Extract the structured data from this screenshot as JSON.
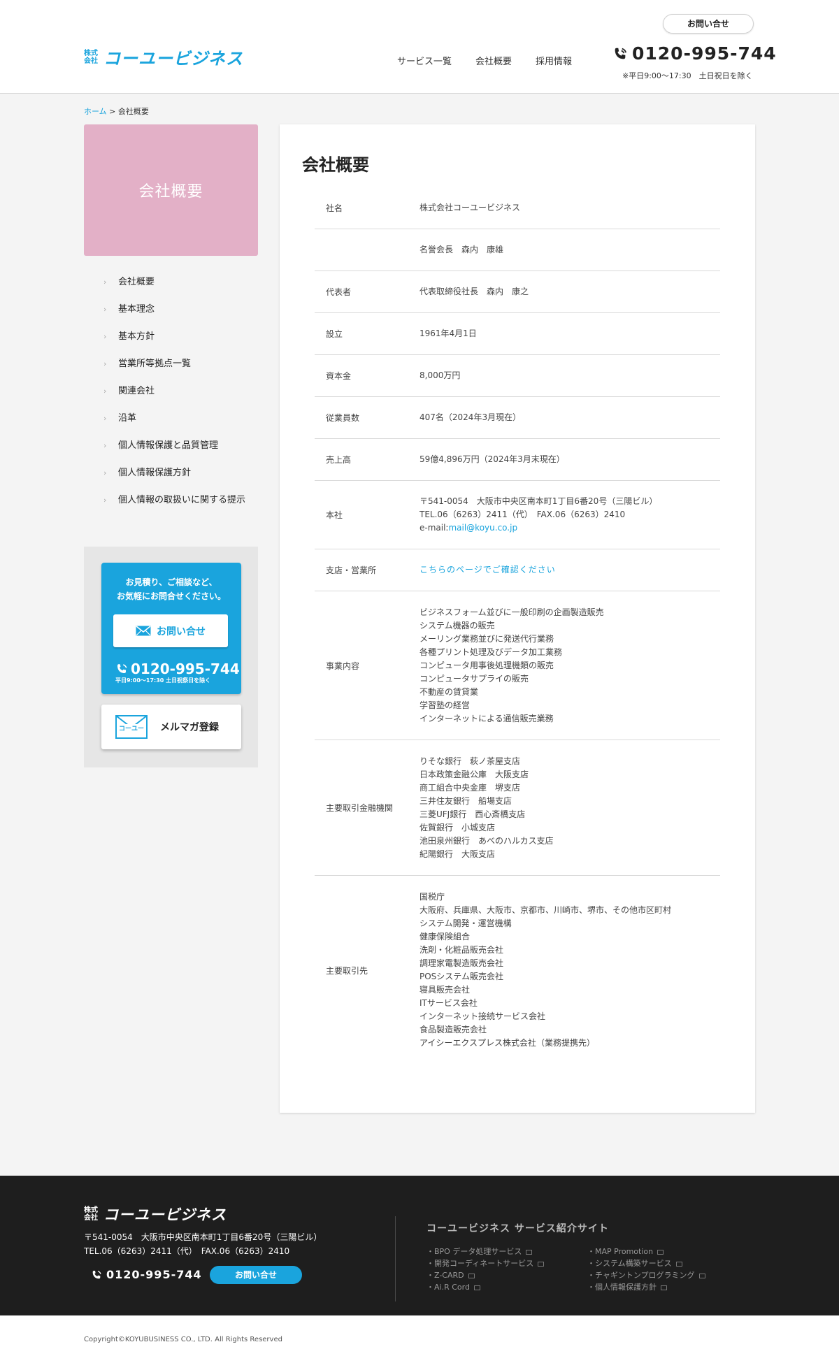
{
  "header": {
    "logo_kaisha_1": "株式",
    "logo_kaisha_2": "会社",
    "logo_text": "コーユービジネス",
    "contact_pill": "お問い合せ",
    "nav": [
      "サービス一覧",
      "会社概要",
      "採用情報"
    ],
    "phone": "0120-995-744",
    "phone_hours": "※平日9:00〜17:30　土日祝日を除く"
  },
  "breadcrumb": {
    "home": "ホーム",
    "separator": " > ",
    "current": "会社概要"
  },
  "sidebar": {
    "title": "会社概要",
    "menu": [
      "会社概要",
      "基本理念",
      "基本方針",
      "営業所等拠点一覧",
      "関連会社",
      "沿革",
      "個人情報保護と品質管理",
      "個人情報保護方針",
      "個人情報の取扱いに関する提示"
    ],
    "cta_text_1": "お見積り、ご相談など、",
    "cta_text_2": "お気軽にお問合せください。",
    "cta_button": "お問い合せ",
    "cta_phone": "0120-995-744",
    "cta_hours": "平日9:00〜17:30  土日祝祭日を除く",
    "mailmag_logo": "コーユー",
    "mailmag_label": "メルマガ登録"
  },
  "main": {
    "title": "会社概要",
    "rows": [
      {
        "label": "社名",
        "lines": [
          "株式会社コーユービジネス"
        ]
      },
      {
        "label": "",
        "lines": [
          "名誉会長　森内　康雄"
        ]
      },
      {
        "label": "代表者",
        "lines": [
          "代表取締役社長　森内　康之"
        ]
      },
      {
        "label": "設立",
        "lines": [
          "1961年4月1日"
        ]
      },
      {
        "label": "資本金",
        "lines": [
          "8,000万円"
        ]
      },
      {
        "label": "従業員数",
        "lines": [
          "407名（2024年3月現在）"
        ]
      },
      {
        "label": "売上高",
        "lines": [
          "59億4,896万円（2024年3月末現在）"
        ]
      },
      {
        "label": "本社",
        "lines": [
          "〒541-0054　大阪市中央区南本町1丁目6番20号（三陽ビル）",
          "TEL.06（6263）2411（代）　FAX.06（6263）2410"
        ],
        "email_prefix": "e-mail:",
        "email": "mail@koyu.co.jp"
      },
      {
        "label": "支店・営業所",
        "link": "こちらのページでご確認ください"
      },
      {
        "label": "事業内容",
        "lines": [
          "ビジネスフォーム並びに一般印刷の企画製造販売",
          "システム機器の販売",
          "メーリング業務並びに発送代行業務",
          "各種プリント処理及びデータ加工業務",
          "コンピュータ用事後処理機類の販売",
          "コンピュータサプライの販売",
          "不動産の賃貸業",
          "学習塾の経営",
          "インターネットによる通信販売業務"
        ]
      },
      {
        "label": "主要取引金融機関",
        "lines": [
          "りそな銀行　萩ノ茶屋支店",
          "日本政策金融公庫　大阪支店",
          "商工組合中央金庫　堺支店",
          "三井住友銀行　船場支店",
          "三菱UFJ銀行　西心斎橋支店",
          "佐賀銀行　小城支店",
          "池田泉州銀行　あべのハルカス支店",
          "紀陽銀行　大阪支店"
        ]
      },
      {
        "label": "主要取引先",
        "lines": [
          "国税庁",
          "大阪府、兵庫県、大阪市、京都市、川崎市、堺市、その他市区町村",
          "システム開発・運営機構",
          "健康保険組合",
          "洗剤・化粧品販売会社",
          "調理家電製造販売会社",
          "POSシステム販売会社",
          "寝具販売会社",
          "ITサービス会社",
          "インターネット接続サービス会社",
          "食品製造販売会社",
          "アイシーエクスプレス株式会社（業務提携先）"
        ]
      }
    ]
  },
  "footer": {
    "logo_kaisha_1": "株式",
    "logo_kaisha_2": "会社",
    "logo_text": "コーユービジネス",
    "address_1": "〒541-0054　大阪市中央区南本町1丁目6番20号（三陽ビル）",
    "address_2": "TEL.06（6263）2411（代）　FAX.06（6263）2410",
    "phone": "0120-995-744",
    "contact": "お問い合せ",
    "sites_title": "コーユービジネス サービス紹介サイト",
    "links_col1": [
      "BPO データ処理サービス",
      "開発コーディネートサービス",
      "Z-CARD",
      "Ai.R Cord"
    ],
    "links_col2": [
      "MAP Promotion",
      "システム構築サービス",
      "チャギントンプログラミング",
      "個人情報保護方針"
    ],
    "copyright": "Copyright©KOYUBUSINESS CO., LTD. All Rights Reserved"
  },
  "colors": {
    "accent": "#1aa4dd",
    "sidebar_title_bg": "#e3b0c7",
    "footer_bg": "#1e1e1e"
  }
}
